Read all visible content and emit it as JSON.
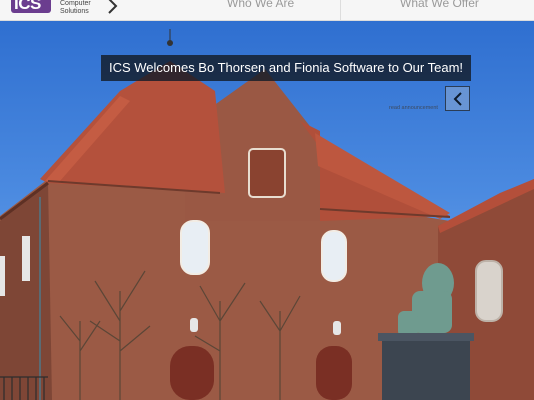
{
  "header": {
    "logo_letters": "ICS",
    "logo_line1": "Computer",
    "logo_line2": "Solutions",
    "nav": [
      {
        "label": "Who We Are"
      },
      {
        "label": "What We Offer"
      }
    ]
  },
  "hero": {
    "announcement": "ICS Welcomes Bo Thorsen and Fionia Software to Our Team!",
    "read_link": "read announcement",
    "prev_icon": "chevron-left-icon"
  },
  "colors": {
    "brand": "#6b3d8f",
    "banner_bg": "#141c28",
    "sky": "#3a7ad8",
    "brick": "#9a5a44",
    "roof": "#b5503a"
  }
}
